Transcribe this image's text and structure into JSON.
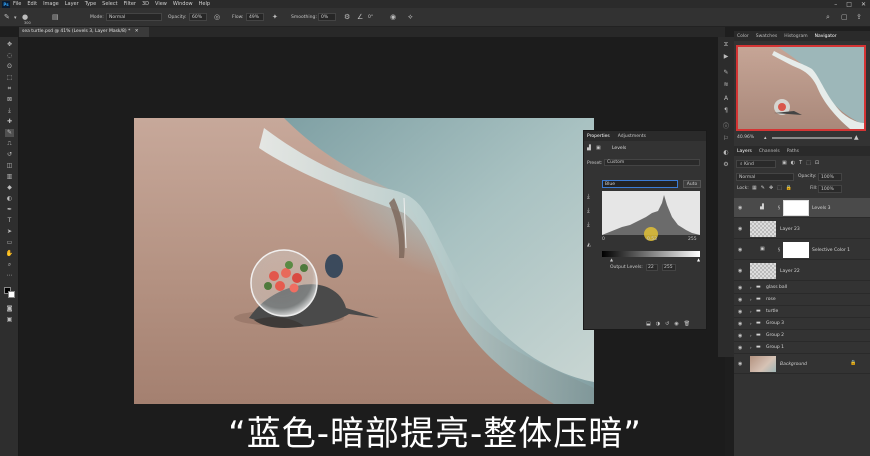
{
  "menu": {
    "app_icon": "Ps",
    "items": [
      "File",
      "Edit",
      "Image",
      "Layer",
      "Type",
      "Select",
      "Filter",
      "3D",
      "View",
      "Window",
      "Help"
    ]
  },
  "options_bar": {
    "brush_size": "300",
    "mode_label": "Mode:",
    "mode_value": "Normal",
    "opacity_label": "Opacity:",
    "opacity_value": "60%",
    "flow_label": "Flow:",
    "flow_value": "49%",
    "smoothing_label": "Smoothing:",
    "smoothing_value": "0%",
    "angle_value": "0°"
  },
  "document": {
    "tab_title": "sea turtle.psd @ 41% (Levels 3, Layer Mask/8) *"
  },
  "properties": {
    "tabs": [
      "Properties",
      "Adjustments"
    ],
    "panel_name": "Levels",
    "preset_label": "Preset:",
    "preset_value": "Custom",
    "channel_value": "Blue",
    "auto_label": "Auto",
    "input_black": "0",
    "input_mid": "0.53",
    "input_white": "255",
    "output_label": "Output Levels:",
    "output_black": "22",
    "output_white": "255"
  },
  "navigator": {
    "tabs": [
      "Color",
      "Swatches",
      "Histogram",
      "Navigator"
    ],
    "zoom": "40.96%"
  },
  "layers_panel": {
    "tabs": [
      "Layers",
      "Channels",
      "Paths"
    ],
    "filter_label": "Kind",
    "blend_mode": "Normal",
    "opacity_label": "Opacity:",
    "opacity_value": "100%",
    "lock_label": "Lock:",
    "fill_label": "Fill:",
    "fill_value": "100%",
    "layers": [
      {
        "name": "Levels 3",
        "kind": "adjustment"
      },
      {
        "name": "Layer 23",
        "kind": "pixel"
      },
      {
        "name": "Selective Color 1",
        "kind": "adjustment"
      },
      {
        "name": "Layer 22",
        "kind": "pixel"
      },
      {
        "name": "glass ball",
        "kind": "group"
      },
      {
        "name": "rose",
        "kind": "group"
      },
      {
        "name": "turtle",
        "kind": "group"
      },
      {
        "name": "Group 3",
        "kind": "group"
      },
      {
        "name": "Group 2",
        "kind": "group"
      },
      {
        "name": "Group 1",
        "kind": "group"
      },
      {
        "name": "Background",
        "kind": "background"
      }
    ]
  },
  "subtitle": "“蓝色-暗部提亮-整体压暗”"
}
